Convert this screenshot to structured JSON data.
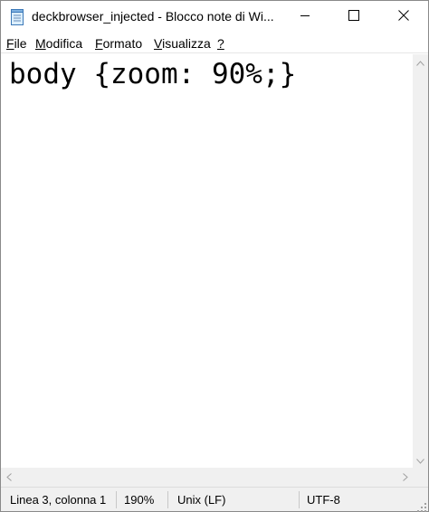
{
  "window": {
    "title": "deckbrowser_injected - Blocco note di Wi...",
    "icons": {
      "app": "notepad-icon",
      "minimize": "minimize-icon",
      "maximize": "maximize-icon",
      "close": "close-icon"
    }
  },
  "menu": {
    "items": [
      {
        "accel": "F",
        "rest": "ile"
      },
      {
        "accel": "M",
        "rest": "odifica"
      },
      {
        "accel": "F",
        "rest": "ormato",
        "pre": ""
      },
      {
        "accel": "V",
        "rest": "isualizza"
      },
      {
        "accel": "?",
        "rest": ""
      }
    ]
  },
  "editor": {
    "content": "body {zoom: 90%;}"
  },
  "status": {
    "position": "Linea 3, colonna 1",
    "zoom": "190%",
    "line_ending": "Unix (LF)",
    "encoding": "UTF-8"
  },
  "colors": {
    "chrome_bg": "#f0f0f0",
    "editor_bg": "#ffffff",
    "text": "#000000"
  }
}
